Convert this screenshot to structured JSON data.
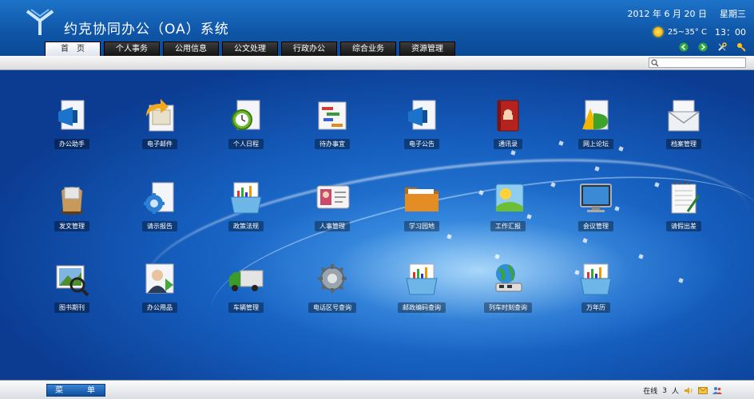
{
  "header": {
    "title": "约克协同办公（OA）系统",
    "date": "2012 年 6 月 20 日",
    "weekday": "星期三",
    "weather": "25~35° C",
    "time": "13：00"
  },
  "tabs": [
    {
      "label": "首　页",
      "active": true
    },
    {
      "label": "个人事务",
      "active": false
    },
    {
      "label": "公用信息",
      "active": false
    },
    {
      "label": "公文处理",
      "active": false
    },
    {
      "label": "行政办公",
      "active": false
    },
    {
      "label": "综合业务",
      "active": false
    },
    {
      "label": "资源管理",
      "active": false
    }
  ],
  "desktop": {
    "row1": [
      {
        "label": "办公助手",
        "icon": "megaphone-document-icon"
      },
      {
        "label": "电子邮件",
        "icon": "email-arrow-icon"
      },
      {
        "label": "个人日程",
        "icon": "alarm-clock-icon"
      },
      {
        "label": "待办事宜",
        "icon": "gantt-document-icon"
      },
      {
        "label": "电子公告",
        "icon": "announcement-megaphone-icon"
      },
      {
        "label": "通讯录",
        "icon": "address-book-icon"
      },
      {
        "label": "网上论坛",
        "icon": "forum-letters-icon"
      },
      {
        "label": "档案管理",
        "icon": "archive-mail-icon"
      }
    ],
    "row2": [
      {
        "label": "发文管理",
        "icon": "outgoing-document-icon"
      },
      {
        "label": "请示报告",
        "icon": "report-gear-icon"
      },
      {
        "label": "政策法规",
        "icon": "policy-chart-tray-icon"
      },
      {
        "label": "人事管理",
        "icon": "personnel-card-icon"
      },
      {
        "label": "学习园地",
        "icon": "study-folder-icon"
      },
      {
        "label": "工作汇报",
        "icon": "work-report-icon"
      },
      {
        "label": "会议管理",
        "icon": "meeting-monitor-icon"
      },
      {
        "label": "请假出差",
        "icon": "leave-calendar-icon"
      }
    ],
    "row3": [
      {
        "label": "图书期刊",
        "icon": "books-magnifier-icon"
      },
      {
        "label": "办公用品",
        "icon": "office-supplies-icon"
      },
      {
        "label": "车辆管理",
        "icon": "truck-icon"
      },
      {
        "label": "电话区号查询",
        "icon": "area-code-gear-icon"
      },
      {
        "label": "邮政编码查询",
        "icon": "postcode-chart-tray-icon"
      },
      {
        "label": "列车时刻查询",
        "icon": "train-schedule-globe-icon"
      },
      {
        "label": "万年历",
        "icon": "calendar-chart-tray-icon"
      }
    ]
  },
  "footer": {
    "menu_label": "菜　单",
    "online_label": "在线",
    "online_count": "3",
    "people_unit": "人"
  }
}
